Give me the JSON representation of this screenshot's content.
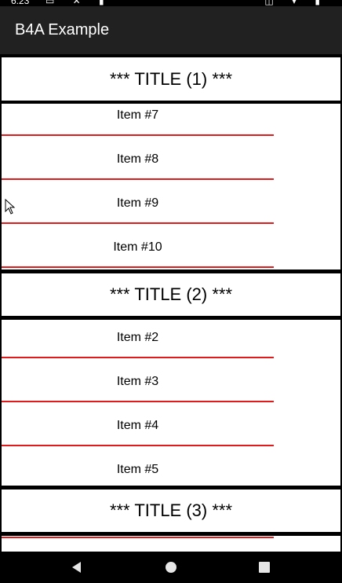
{
  "status_bar": {
    "time": "6:23",
    "left_icons": "▭ ✕ ▮",
    "right_icons": "◫ ▾ ▮"
  },
  "app": {
    "title": "B4A Example"
  },
  "sections": [
    {
      "title": "*** TITLE (1) ***",
      "items": [
        "Item #7",
        "Item #8",
        "Item #9",
        "Item #10"
      ]
    },
    {
      "title": "*** TITLE (2) ***",
      "items": [
        "Item #2",
        "Item #3",
        "Item #4",
        "Item #5"
      ]
    },
    {
      "title": "*** TITLE (3) ***",
      "items": []
    }
  ],
  "colors": {
    "divider": "#e01b1b",
    "app_bar": "#212121"
  },
  "nav": {
    "back_icon": "back-icon",
    "home_icon": "home-icon",
    "recents_icon": "recents-icon"
  }
}
